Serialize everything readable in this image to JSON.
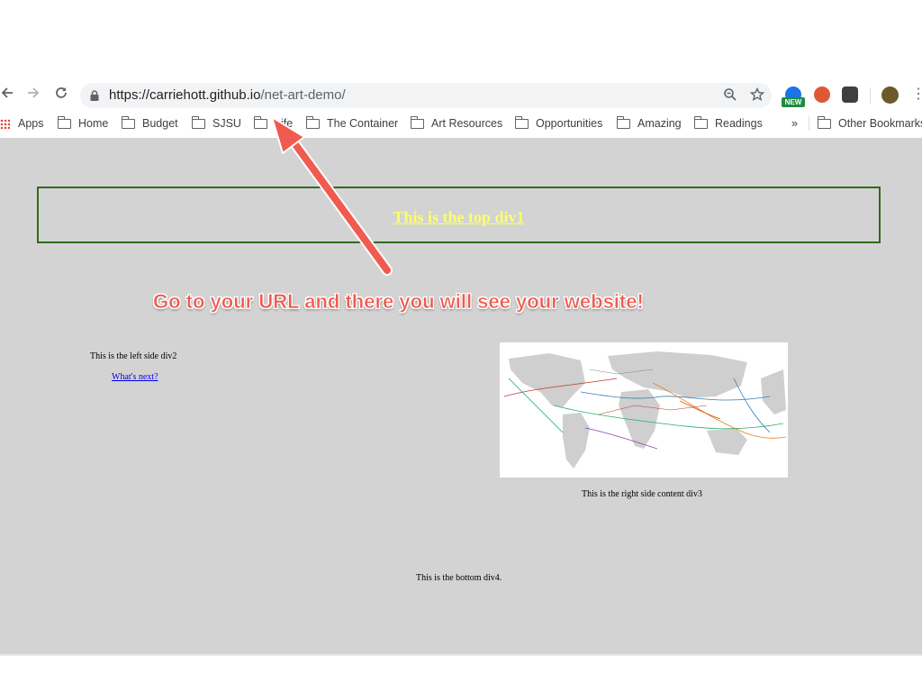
{
  "browser": {
    "url_host": "https://carriehott.github.io",
    "url_path": "/net-art-demo/",
    "extension_badge": "NEW",
    "bookmarks": [
      {
        "label": "Apps",
        "icon": "apps-grid-icon"
      },
      {
        "label": "Home",
        "icon": "folder-icon"
      },
      {
        "label": "Budget",
        "icon": "folder-icon"
      },
      {
        "label": "SJSU",
        "icon": "folder-icon"
      },
      {
        "label": "Life",
        "icon": "folder-icon"
      },
      {
        "label": "The Container",
        "icon": "folder-icon"
      },
      {
        "label": "Art Resources",
        "icon": "folder-icon"
      },
      {
        "label": "Opportunities",
        "icon": "folder-icon"
      },
      {
        "label": "Amazing",
        "icon": "folder-icon"
      },
      {
        "label": "Readings",
        "icon": "folder-icon"
      }
    ],
    "overflow_label": "»",
    "other_bookmarks": "Other Bookmarks"
  },
  "page": {
    "top_div": "This is the top div1",
    "left_div": "This is the left side div2",
    "left_link": "What's next?",
    "right_caption": "This is the right side content div3",
    "bottom_div": "This is the bottom div4."
  },
  "annotation": {
    "text": "Go to your URL and there you will see your website!",
    "color": "#f05a4f"
  },
  "colors": {
    "page_background": "#d3d3d3",
    "top_div_border": "#2d6b1e",
    "top_div_text": "#ffff66",
    "link": "#0000ee"
  }
}
